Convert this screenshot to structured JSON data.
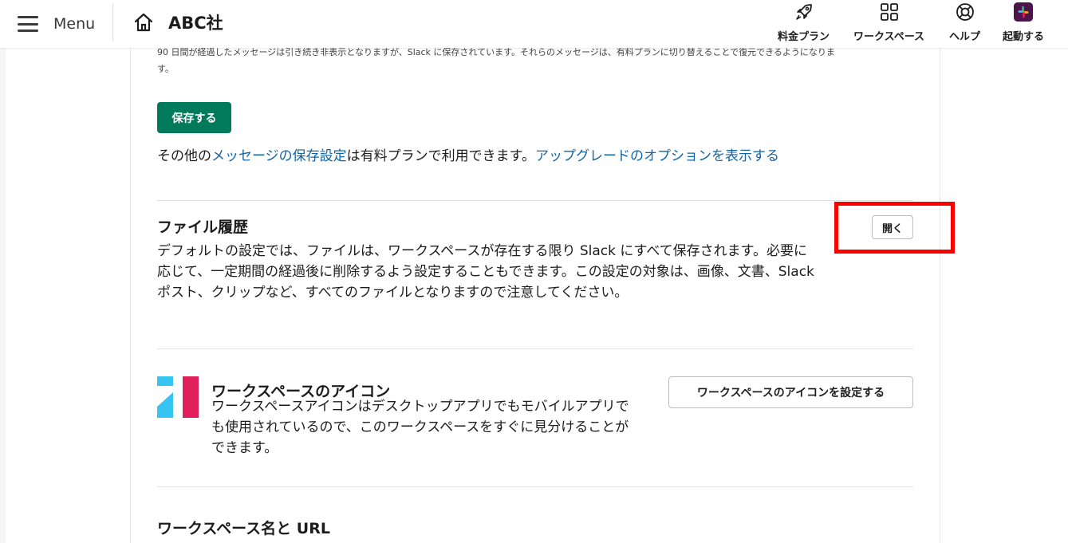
{
  "header": {
    "menu_label": "Menu",
    "workspace_name": "ABC社",
    "nav": {
      "pricing": "料金プラン",
      "workspaces": "ワークスペース",
      "help": "ヘルプ",
      "launch": "起動する"
    }
  },
  "retention": {
    "note": "90 日間が経過したメッセージは引き続き非表示となりますが、Slack に保存されています。それらのメッセージは、有料プランに切り替えることで復元できるようになります。",
    "save_label": "保存する",
    "info_prefix": "その他の",
    "info_link1": "メッセージの保存設定",
    "info_middle": "は有料プランで利用できます。",
    "info_link2": "アップグレードのオプションを表示する"
  },
  "file_history": {
    "title": "ファイル履歴",
    "description": "デフォルトの設定では、ファイルは、ワークスペースが存在する限り Slack にすべて保存されます。必要に応じて、一定期間の経過後に削除するよう設定することもできます。この設定の対象は、画像、文書、Slack ポスト、クリップなど、すべてのファイルとなりますので注意してください。",
    "open_label": "開く"
  },
  "workspace_icon": {
    "title": "ワークスペースのアイコン",
    "description": "ワークスペースアイコンはデスクトップアプリでもモバイルアプリでも使用されているので、このワークスペースをすぐに見分けることができます。",
    "button_label": "ワークスペースのアイコンを設定する"
  },
  "workspace_url": {
    "title": "ワークスペース名と URL"
  },
  "colors": {
    "save_green": "#007a5a",
    "link_blue": "#1264a3",
    "highlight_red": "#ff0000",
    "slack_teal": "#36c5f0",
    "slack_pink": "#e01e5a"
  }
}
